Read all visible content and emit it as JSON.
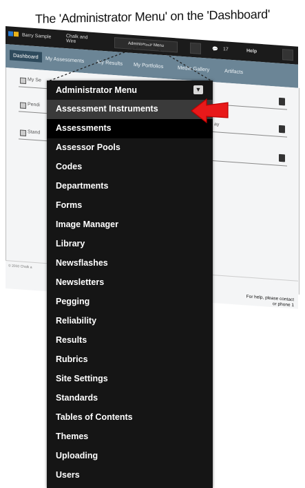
{
  "caption": "The 'Administrator Menu' on the 'Dashboard'",
  "app": {
    "user_name": "Barry Sample",
    "top_text": "Chalk and Wire",
    "admin_button": "Administrator Menu",
    "help_label": "Help",
    "msg_count": "17"
  },
  "tabs": [
    "Dashboard",
    "My Assessments",
    "My Results",
    "My Portfolios",
    "Media Gallery",
    "Artifacts"
  ],
  "widgets": {
    "w1": "My Se",
    "w2": "Pendi",
    "w3": "Stand",
    "w4": "ay"
  },
  "footer": {
    "copyright": "© 2010 Chalk a",
    "help_line1": "For help, please contact",
    "help_line2": "or phone 1"
  },
  "menu": {
    "title": "Administrator Menu",
    "items": [
      "Assessment Instruments",
      "Assessments",
      "Assessor Pools",
      "Codes",
      "Departments",
      "Forms",
      "Image Manager",
      "Library",
      "Newsflashes",
      "Newsletters",
      "Pegging",
      "Reliability",
      "Results",
      "Rubrics",
      "Site Settings",
      "Standards",
      "Tables of Contents",
      "Themes",
      "Uploading",
      "Users"
    ]
  },
  "colors": {
    "menu_bg": "#151515",
    "menu_highlight": "#3a3a3a",
    "nav_bg": "#6b8596",
    "arrow": "#e8191a"
  }
}
